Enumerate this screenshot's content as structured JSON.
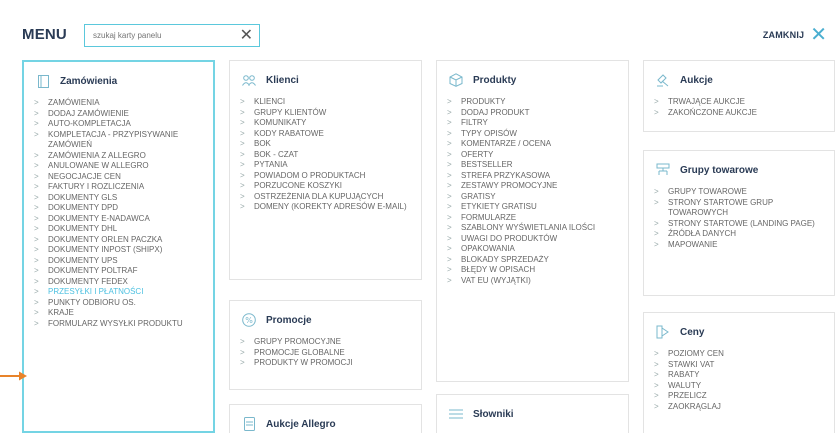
{
  "menu": {
    "title": "MENU",
    "close_label": "ZAMKNIJ"
  },
  "search": {
    "placeholder": "szukaj karty panelu"
  },
  "cards": {
    "zamowienia": {
      "title": "Zamówienia",
      "items": [
        "ZAMÓWIENIA",
        "DODAJ ZAMÓWIENIE",
        "AUTO-KOMPLETACJA",
        "KOMPLETACJA - PRZYPISYWANIE ZAMÓWIEŃ",
        "ZAMÓWIENIA Z ALLEGRO",
        "ANULOWANE W ALLEGRO",
        "NEGOCJACJE CEN",
        "FAKTURY I ROZLICZENIA",
        "DOKUMENTY GLS",
        "DOKUMENTY DPD",
        "DOKUMENTY E-NADAWCA",
        "DOKUMENTY DHL",
        "DOKUMENTY ORLEN PACZKA",
        "DOKUMENTY INPOST (SHIPX)",
        "DOKUMENTY UPS",
        "DOKUMENTY POLTRAF",
        "DOKUMENTY FEDEX",
        "PRZESYŁKI I PŁATNOŚCI",
        "PUNKTY ODBIORU OS.",
        "KRAJE",
        "FORMULARZ WYSYŁKI PRODUKTU"
      ]
    },
    "klienci": {
      "title": "Klienci",
      "items": [
        "KLIENCI",
        "GRUPY KLIENTÓW",
        "KOMUNIKATY",
        "KODY RABATOWE",
        "BOK",
        "BOK - CZAT",
        "PYTANIA",
        "POWIADOM O PRODUKTACH",
        "PORZUCONE KOSZYKI",
        "OSTRZEŻENIA DLA KUPUJĄCYCH",
        "DOMENY (KOREKTY ADRESÓW E-MAIL)"
      ]
    },
    "promocje": {
      "title": "Promocje",
      "items": [
        "GRUPY PROMOCYJNE",
        "PROMOCJE GLOBALNE",
        "PRODUKTY W PROMOCJI"
      ]
    },
    "aukcje_allegro": {
      "title": "Aukcje Allegro"
    },
    "produkty": {
      "title": "Produkty",
      "items": [
        "PRODUKTY",
        "DODAJ PRODUKT",
        "FILTRY",
        "TYPY OPISÓW",
        "KOMENTARZE / OCENA",
        "OFERTY",
        "BESTSELLER",
        "STREFA PRZYKASOWA",
        "ZESTAWY PROMOCYJNE",
        "GRATISY",
        "ETYKIETY GRATISU",
        "FORMULARZE",
        "SZABLONY WYŚWIETLANIA ILOŚCI",
        "UWAGI DO PRODUKTÓW",
        "OPAKOWANIA",
        "BLOKADY SPRZEDAŻY",
        "BŁĘDY W OPISACH",
        "VAT EU (WYJĄTKI)"
      ]
    },
    "slowniki": {
      "title": "Słowniki"
    },
    "aukcje": {
      "title": "Aukcje",
      "items": [
        "TRWAJĄCE AUKCJE",
        "ZAKOŃCZONE AUKCJE"
      ]
    },
    "grupy_towarowe": {
      "title": "Grupy towarowe",
      "items": [
        "GRUPY TOWAROWE",
        "STRONY STARTOWE GRUP TOWAROWYCH",
        "STRONY STARTOWE (LANDING PAGE)",
        "ŹRÓDŁA DANYCH",
        "MAPOWANIE"
      ]
    },
    "ceny": {
      "title": "Ceny",
      "items": [
        "POZIOMY CEN",
        "STAWKI VAT",
        "RABATY",
        "WALUTY",
        "PRZELICZ",
        "ZAOKRĄGLAJ"
      ]
    }
  },
  "colors": {
    "accent": "#74d4e4",
    "highlight": "#4cc0e0",
    "arrow": "#e8832a",
    "heading": "#2a3b55"
  },
  "icons": {
    "zamowienia": "document-icon",
    "klienci": "users-icon",
    "promocje": "percent-icon",
    "aukcje_allegro": "phone-icon",
    "produkty": "box-icon",
    "slowniki": "list-icon",
    "aukcje": "auction-icon",
    "grupy_towarowe": "group-icon",
    "ceny": "price-icon"
  }
}
